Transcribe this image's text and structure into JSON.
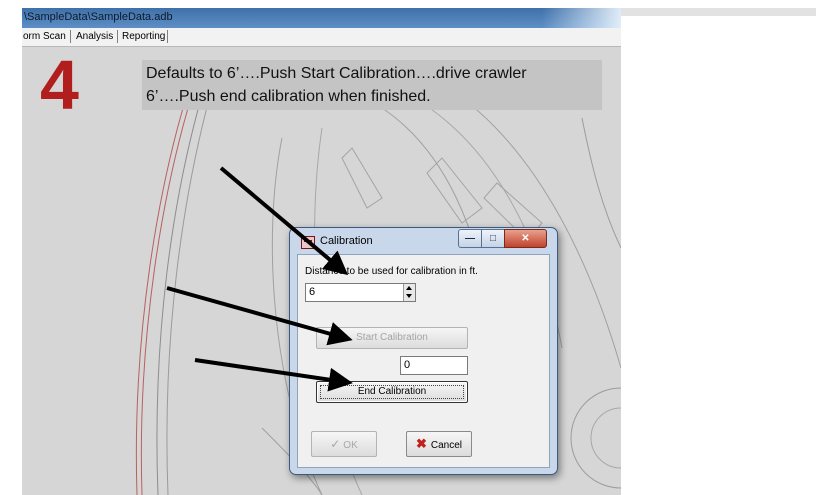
{
  "window": {
    "title": "\\SampleData\\SampleData.adb"
  },
  "tabs": [
    {
      "label": "orm Scan"
    },
    {
      "label": "Analysis"
    },
    {
      "label": "Reporting"
    }
  ],
  "instruction": {
    "step": "4",
    "line1": "Defaults to 6’….Push Start Calibration….drive crawler",
    "line2": "6’….Push end calibration when finished."
  },
  "dialog": {
    "title": "Calibration",
    "distance_label": "Distance to be used for calibration in ft.",
    "distance_value": "6",
    "start_button": "Start Calibration",
    "count_value": "0",
    "end_button": "End Calibration",
    "ok_button": "OK",
    "cancel_button": "Cancel"
  },
  "icons": {
    "minimize": "minimize-icon",
    "maximize": "maximize-icon",
    "close": "close-icon",
    "ok": "check-icon",
    "cancel": "cancel-x-icon"
  },
  "colors": {
    "step_number": "#b21e1e",
    "titlebar": "#4a7cb4",
    "arrow": "#000000"
  }
}
